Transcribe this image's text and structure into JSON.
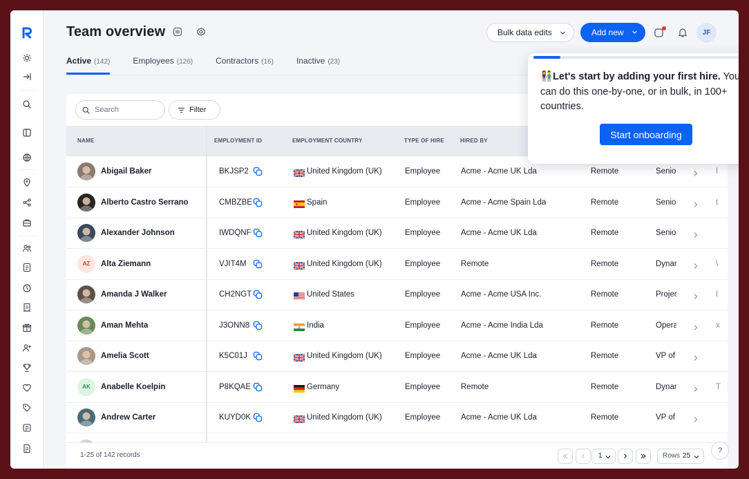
{
  "header": {
    "title": "Team overview",
    "bulk_label": "Bulk data edits",
    "add_label": "Add new",
    "avatar_initials": "JF"
  },
  "tabs": [
    {
      "label": "Active",
      "count": "(142)"
    },
    {
      "label": "Employees",
      "count": "(126)"
    },
    {
      "label": "Contractors",
      "count": "(16)"
    },
    {
      "label": "Inactive",
      "count": "(23)"
    }
  ],
  "toolbar": {
    "search_placeholder": "Search",
    "filter_label": "Filter"
  },
  "columns": {
    "name": "NAME",
    "employment_id": "EMPLOYMENT ID",
    "country": "EMPLOYMENT COUNTRY",
    "type": "TYPE OF HIRE",
    "hired_by": "HIRED BY"
  },
  "rows": [
    {
      "name": "Abigail Baker",
      "eid": "BKJSP2",
      "flag": "uk",
      "country": "United Kingdom (UK)",
      "type": "Employee",
      "hired_by": "Acme - Acme UK Lda",
      "work": "Remote",
      "role": "Senio",
      "extra": "I",
      "avatar": {
        "kind": "photo",
        "bg": "#8a7a70"
      }
    },
    {
      "name": "Alberto Castro Serrano",
      "eid": "CMBZBE",
      "flag": "es",
      "country": "Spain",
      "type": "Employee",
      "hired_by": "Acme - Acme Spain Lda",
      "work": "Remote",
      "role": "Senio",
      "extra": "t",
      "avatar": {
        "kind": "photo",
        "bg": "#2a2522"
      }
    },
    {
      "name": "Alexander Johnson",
      "eid": "IWDQNF",
      "flag": "uk",
      "country": "United Kingdom (UK)",
      "type": "Employee",
      "hired_by": "Acme - Acme UK Lda",
      "work": "Remote",
      "role": "Senio",
      "extra": "",
      "avatar": {
        "kind": "photo",
        "bg": "#3b4a5a"
      }
    },
    {
      "name": "Alta Ziemann",
      "eid": "VJIT4M",
      "flag": "uk",
      "country": "United Kingdom (UK)",
      "type": "Employee",
      "hired_by": "Remote",
      "work": "Remote",
      "role": "Dynar",
      "extra": "\\",
      "avatar": {
        "kind": "initials",
        "text": "AZ",
        "bg": "#fde6df",
        "color": "#c24a3a"
      }
    },
    {
      "name": "Amanda J Walker",
      "eid": "CH2NGT",
      "flag": "us",
      "country": "United States",
      "type": "Employee",
      "hired_by": "Acme - Acme USA Inc.",
      "work": "Remote",
      "role": "Projec",
      "extra": "I",
      "avatar": {
        "kind": "photo",
        "bg": "#5c5048"
      }
    },
    {
      "name": "Aman Mehta",
      "eid": "J3ONN8",
      "flag": "in",
      "country": "India",
      "type": "Employee",
      "hired_by": "Acme - Acme India Lda",
      "work": "Remote",
      "role": "Opera",
      "extra": "x",
      "avatar": {
        "kind": "photo",
        "bg": "#6a8a5a"
      }
    },
    {
      "name": "Amelia Scott",
      "eid": "K5C01J",
      "flag": "uk",
      "country": "United Kingdom (UK)",
      "type": "Employee",
      "hired_by": "Acme - Acme UK Lda",
      "work": "Remote",
      "role": "VP of",
      "extra": "",
      "avatar": {
        "kind": "photo",
        "bg": "#a89888"
      }
    },
    {
      "name": "Anabelle Koelpin",
      "eid": "P8KQAE",
      "flag": "de",
      "country": "Germany",
      "type": "Employee",
      "hired_by": "Remote",
      "work": "Remote",
      "role": "Dynar",
      "extra": "T",
      "avatar": {
        "kind": "initials",
        "text": "AK",
        "bg": "#dcf5e3",
        "color": "#2f8a4e"
      }
    },
    {
      "name": "Andrew Carter",
      "eid": "KUYD0K",
      "flag": "uk",
      "country": "United Kingdom (UK)",
      "type": "Employee",
      "hired_by": "Acme - Acme UK Lda",
      "work": "Remote",
      "role": "VP of",
      "extra": "",
      "avatar": {
        "kind": "photo",
        "bg": "#4a6a7a"
      }
    }
  ],
  "footer": {
    "records": "1-25 of 142 records",
    "page": "1",
    "rows_label": "Rows",
    "rows_value": "25"
  },
  "popover": {
    "emoji": "👫",
    "bold": "Let's start by adding your first hire.",
    "text": " You can do this one-by-one, or in bulk, in 100+ countries.",
    "button": "Start onboarding",
    "progress": 0.12
  },
  "colors": {
    "accent": "#0b62f3",
    "frame": "#5a1218"
  },
  "help_label": "?"
}
